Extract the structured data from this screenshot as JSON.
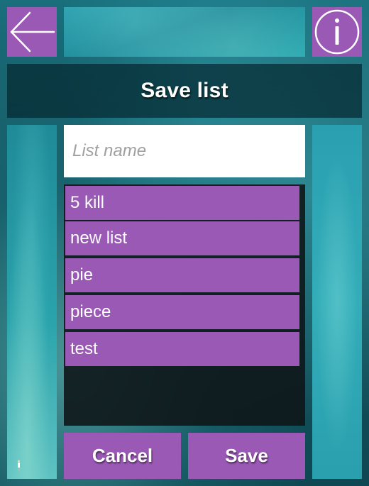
{
  "header": {
    "title": "Save list",
    "back_icon": "arrow-left-icon",
    "info_icon": "info-icon"
  },
  "form": {
    "list_name_value": "",
    "list_name_placeholder": "List name"
  },
  "lists": [
    {
      "label": "5 kill"
    },
    {
      "label": "new list"
    },
    {
      "label": "pie"
    },
    {
      "label": "piece"
    },
    {
      "label": "test"
    }
  ],
  "actions": {
    "cancel_label": "Cancel",
    "save_label": "Save"
  },
  "colors": {
    "accent": "#9b59b6",
    "title_bar": "#06282f",
    "list_background": "#0e1618",
    "text": "#ffffff"
  }
}
